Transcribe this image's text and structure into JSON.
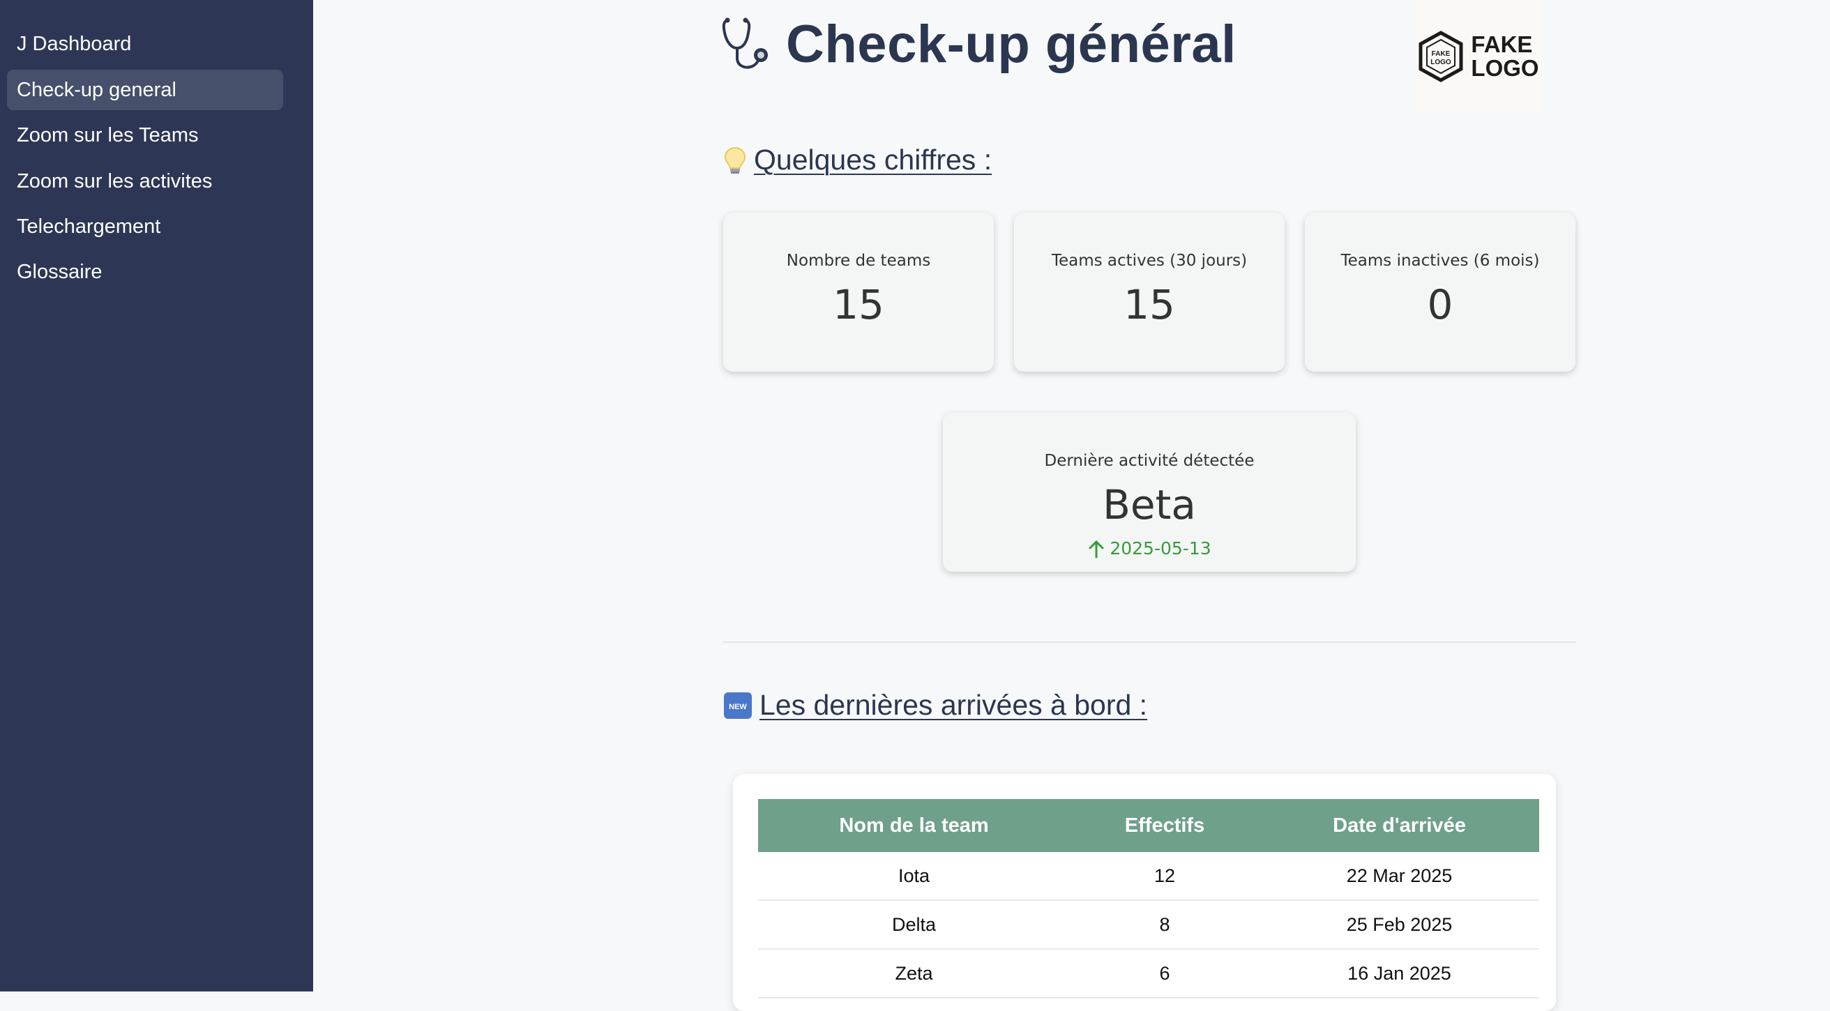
{
  "sidebar": {
    "items": [
      {
        "label": "J Dashboard",
        "active": false
      },
      {
        "label": "Check-up general",
        "active": true
      },
      {
        "label": "Zoom sur les Teams",
        "active": false
      },
      {
        "label": "Zoom sur les activites",
        "active": false
      },
      {
        "label": "Telechargement",
        "active": false
      },
      {
        "label": "Glossaire",
        "active": false
      }
    ]
  },
  "header": {
    "title": "Check-up général",
    "title_icon": "stethoscope-icon",
    "logo_text": [
      "FAKE",
      "LOGO"
    ],
    "logo_badge_text": [
      "FAKE",
      "LOGO"
    ]
  },
  "sections": {
    "figures_heading": "Quelques chiffres :",
    "figures_icon": "lightbulb-icon",
    "arrivals_heading": "Les dernières arrivées à bord :",
    "arrivals_icon": "new-badge-icon"
  },
  "metrics": [
    {
      "label": "Nombre de teams",
      "value": "15"
    },
    {
      "label": "Teams actives (30 jours)",
      "value": "15"
    },
    {
      "label": "Teams inactives (6 mois)",
      "value": "0"
    }
  ],
  "last_activity": {
    "label": "Dernière activité détectée",
    "value": "Beta",
    "delta": "2025-05-13",
    "delta_color": "#3a9a3a"
  },
  "arrivals_table": {
    "columns": [
      "Nom de la team",
      "Effectifs",
      "Date d'arrivée"
    ],
    "rows": [
      [
        "Iota",
        "12",
        "22 Mar 2025"
      ],
      [
        "Delta",
        "8",
        "25 Feb 2025"
      ],
      [
        "Zeta",
        "6",
        "16 Jan 2025"
      ]
    ]
  },
  "colors": {
    "sidebar_bg": "#2d3755",
    "sidebar_active": "#46506b",
    "heading": "#2b3650",
    "table_header": "#6fa08a"
  }
}
